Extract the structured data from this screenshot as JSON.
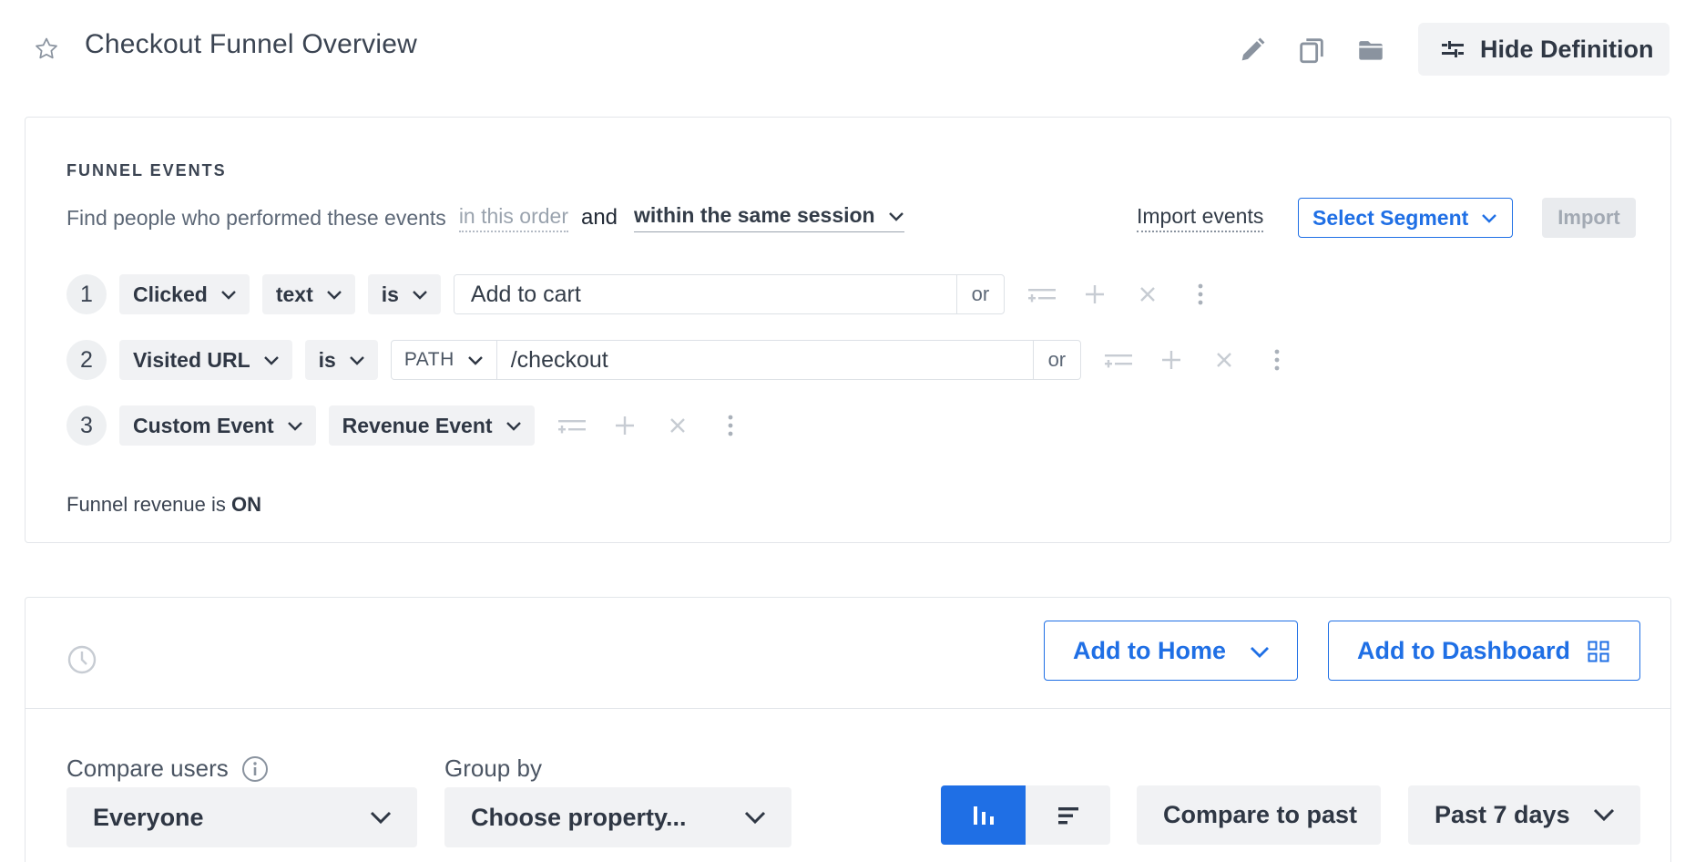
{
  "header": {
    "title": "Checkout Funnel Overview",
    "hide_definition_label": "Hide Definition",
    "icons": [
      "star-icon",
      "pencil-icon",
      "copy-icon",
      "folder-icon",
      "sliders-icon"
    ]
  },
  "funnel": {
    "section_title": "FUNNEL EVENTS",
    "find_text": "Find people who performed these events",
    "order_text": "in this order",
    "and_text": "and",
    "session_option": "within the same session",
    "import_events_label": "Import events",
    "select_segment_label": "Select Segment",
    "import_label": "Import",
    "steps": [
      {
        "number": "1",
        "event": "Clicked",
        "property": "text",
        "operator": "is",
        "value": "Add to cart",
        "or_label": "or"
      },
      {
        "number": "2",
        "event": "Visited URL",
        "operator": "is",
        "url_part": "PATH",
        "value": "/checkout",
        "or_label": "or"
      },
      {
        "number": "3",
        "event": "Custom Event",
        "custom_name": "Revenue Event"
      }
    ],
    "revenue_text": "Funnel revenue is",
    "revenue_state": "ON"
  },
  "report": {
    "add_home_label": "Add to Home",
    "add_dashboard_label": "Add to Dashboard",
    "compare_users_label": "Compare users",
    "compare_users_value": "Everyone",
    "group_by_label": "Group by",
    "group_by_placeholder": "Choose property...",
    "compare_past_label": "Compare to past",
    "date_range_value": "Past 7 days",
    "active_chart_view": "vertical-bars"
  },
  "colors": {
    "accent": "#1f6fe5",
    "chip_bg": "#f1f2f4",
    "text": "#2f3744",
    "muted_icon": "#c7ccd3"
  }
}
